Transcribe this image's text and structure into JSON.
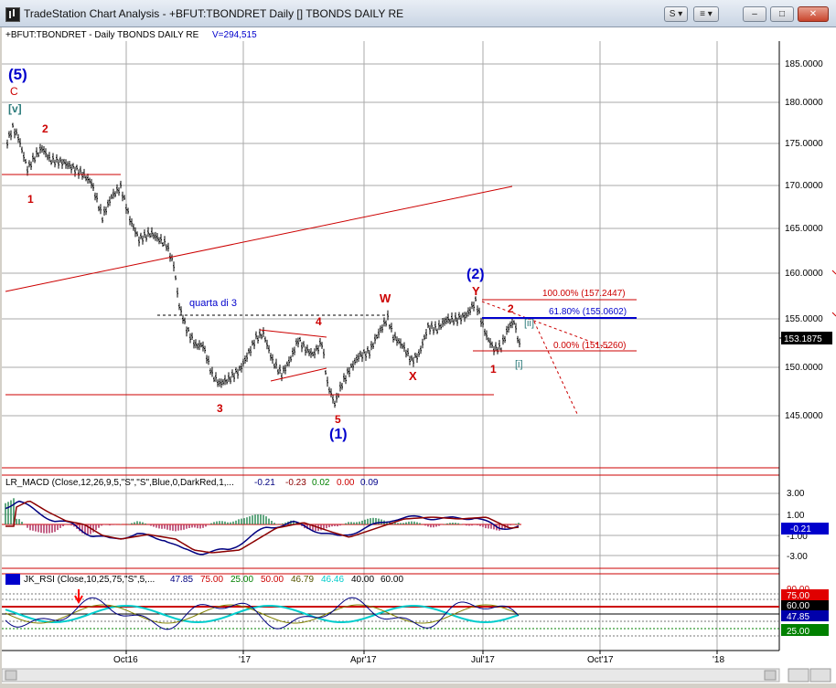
{
  "window": {
    "title": "TradeStation Chart Analysis - +BFUT:TBONDRET Daily [] TBONDS DAILY RE",
    "buttons": {
      "symbol": "S",
      "list": "≡",
      "minimize": "–",
      "maximize": "□",
      "close": "✕"
    }
  },
  "chart": {
    "header": "+BFUT:TBONDRET - Daily  TBONDS DAILY RE",
    "volume_label": "V=294,515",
    "price_axis": [
      "185.0000",
      "180.0000",
      "175.0000",
      "170.0000",
      "165.0000",
      "160.0000",
      "155.0000",
      "150.0000",
      "145.0000"
    ],
    "last_price": "153.1875",
    "time_axis": [
      "Oct16",
      "'17",
      "Apr'17",
      "Jul'17",
      "Oct'17",
      "'18"
    ],
    "wave_labels": {
      "w5": "(5)",
      "c": "C",
      "v": "[v]",
      "w1a": "1",
      "w2a": "2",
      "w3": "3",
      "w4": "4",
      "w5s": "5",
      "w1big": "(1)",
      "w": "W",
      "x": "X",
      "y": "Y",
      "w2big": "(2)",
      "w1b": "1",
      "w2b": "2",
      "ii": "[ii]",
      "i": "[i]"
    },
    "annotation_quarta": "quarta di 3",
    "fib": {
      "f100": "100.00% (157.2447)",
      "f618": "61.80% (155.0602)",
      "f0": "0.00% (151.5260)"
    }
  },
  "macd": {
    "label": "LR_MACD (Close,12,26,9,5,\"S\",\"S\",Blue,0,DarkRed,1,...",
    "values": [
      "-0.21",
      "-0.23",
      "0.02",
      "0.00",
      "0.09"
    ],
    "value_colors": [
      "#000080",
      "#8b0000",
      "#008000",
      "#cc0000",
      "#00008b"
    ],
    "axis": [
      "3.00",
      "1.00",
      "-1.00",
      "-3.00"
    ],
    "last": "-0.21"
  },
  "rsi": {
    "label": "JK_RSI (Close,10,25,75,\"S\",5,...",
    "values": [
      "47.85",
      "75.00",
      "25.00",
      "50.00",
      "46.79",
      "46.46",
      "40.00",
      "60.00"
    ],
    "value_colors": [
      "#000080",
      "#cc0000",
      "#008000",
      "#cc0000",
      "#555500",
      "#00cccc",
      "#000000",
      "#000000"
    ],
    "axis_top": "90.00",
    "badges": [
      "75.00",
      "60.00",
      "47.85",
      "25.00"
    ],
    "badge_colors": [
      "#e00000",
      "#000000",
      "#0000aa",
      "#008000"
    ]
  }
}
